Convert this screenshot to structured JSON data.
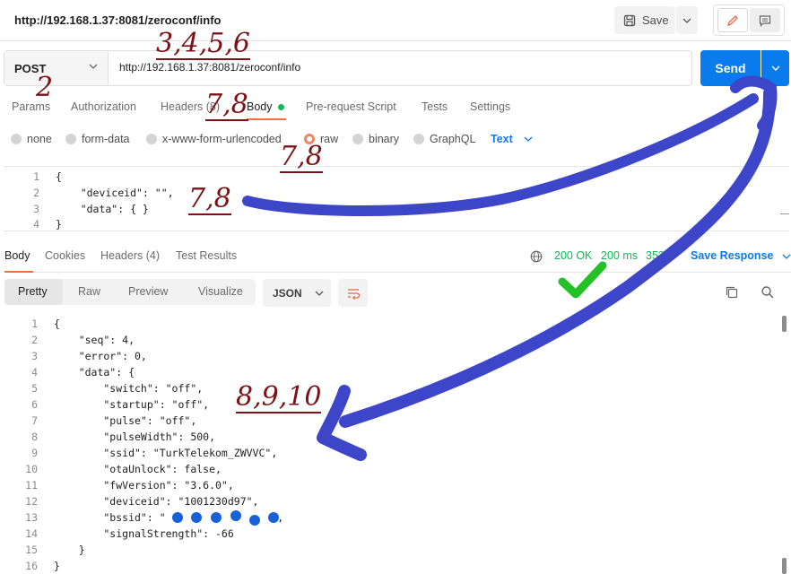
{
  "request": {
    "title": "http://192.168.1.37:8081/zeroconf/info",
    "save_label": "Save",
    "method": "POST",
    "url": "http://192.168.1.37:8081/zeroconf/info",
    "send_label": "Send"
  },
  "request_tabs": [
    {
      "label": "Params"
    },
    {
      "label": "Authorization"
    },
    {
      "label": "Headers (8)"
    },
    {
      "label": "Body"
    },
    {
      "label": "Pre-request Script"
    },
    {
      "label": "Tests"
    },
    {
      "label": "Settings"
    }
  ],
  "body_types": [
    {
      "label": "none"
    },
    {
      "label": "form-data"
    },
    {
      "label": "x-www-form-urlencoded"
    },
    {
      "label": "raw"
    },
    {
      "label": "binary"
    },
    {
      "label": "GraphQL"
    }
  ],
  "body_language": "Text",
  "request_body": {
    "line_numbers": [
      "1",
      "2",
      "3",
      "4"
    ],
    "lines": [
      "{",
      "    \"deviceid\": \"\",",
      "    \"data\": { }",
      "}"
    ]
  },
  "response_tabs": [
    {
      "label": "Body"
    },
    {
      "label": "Cookies"
    },
    {
      "label": "Headers (4)"
    },
    {
      "label": "Test Results"
    }
  ],
  "response_status": {
    "status": "200 OK",
    "time": "200 ms",
    "size": "353 B",
    "save_response": "Save Response"
  },
  "view_modes": [
    {
      "label": "Pretty"
    },
    {
      "label": "Raw"
    },
    {
      "label": "Preview"
    },
    {
      "label": "Visualize"
    }
  ],
  "response_format": "JSON",
  "response_body": {
    "line_numbers": [
      "1",
      "2",
      "3",
      "4",
      "5",
      "6",
      "7",
      "8",
      "9",
      "10",
      "11",
      "12",
      "13",
      "14",
      "15",
      "16"
    ],
    "lines": [
      "{",
      "    \"seq\": 4,",
      "    \"error\": 0,",
      "    \"data\": {",
      "        \"switch\": \"off\",",
      "        \"startup\": \"off\",",
      "        \"pulse\": \"off\",",
      "        \"pulseWidth\": 500,",
      "        \"ssid\": \"TurkTelekom_ZWVVC\",",
      "        \"otaUnlock\": false,",
      "        \"fwVersion\": \"3.6.0\",",
      "        \"deviceid\": \"1001230d97\",",
      "        \"bssid\": \"  :  :  :  :  :  \",",
      "        \"signalStrength\": -66",
      "    }",
      "}"
    ]
  },
  "annotations": [
    {
      "text": "3,4,5,6"
    },
    {
      "text": "2"
    },
    {
      "text": "7,8"
    },
    {
      "text": "7,8"
    },
    {
      "text": "7,8"
    },
    {
      "text": "8,9,10"
    }
  ],
  "colors": {
    "accent": "#097bed",
    "tab_underline": "#ff6c37",
    "status_ok": "#0cbb52",
    "annotation_ink": "#7a1216",
    "marker_stroke": "#3d45c8",
    "redaction_dot": "#1763d6",
    "check_mark": "#22c226"
  },
  "icons": [
    "save-icon",
    "chevron-down-icon",
    "pencil-icon",
    "comment-icon",
    "globe-icon",
    "wrap-icon",
    "copy-icon",
    "search-icon"
  ]
}
